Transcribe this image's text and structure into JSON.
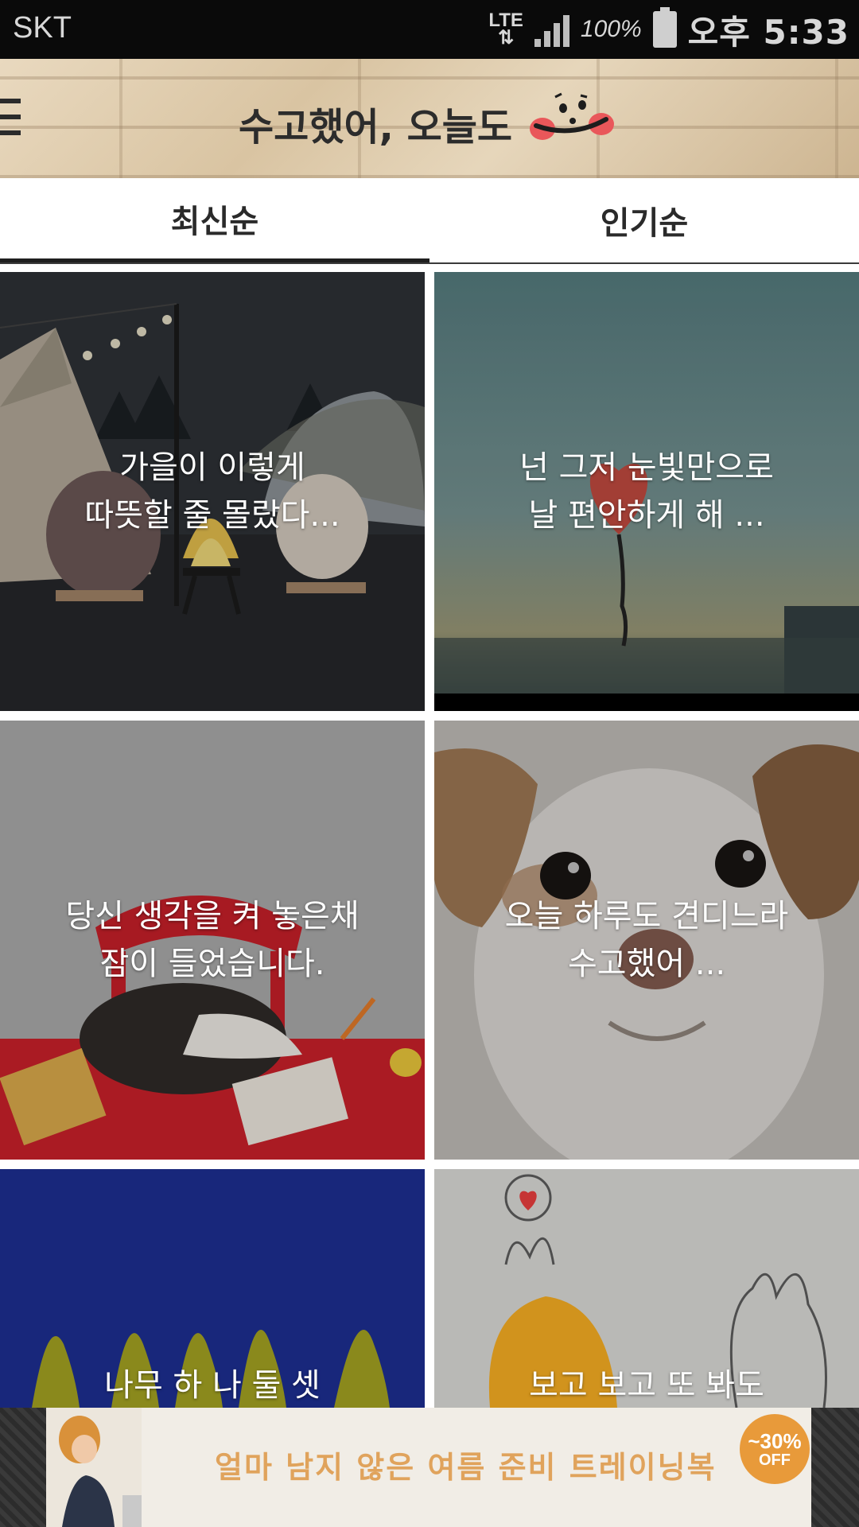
{
  "status_bar": {
    "carrier": "SKT",
    "network": "LTE",
    "battery": "100%",
    "time": "오후 5:33"
  },
  "header": {
    "title": "수고했어, 오늘도",
    "menu_icon": "hamburger-menu-icon",
    "logo_icon": "smiley-face-logo"
  },
  "tabs": [
    {
      "label": "최신순",
      "selected": true
    },
    {
      "label": "인기순",
      "selected": false
    }
  ],
  "cards": [
    {
      "line1": "가을이 이렇게",
      "line2": "따뜻할 줄 몰랐다..."
    },
    {
      "line1": "넌 그저 눈빛만으로",
      "line2": "날 편안하게 해 ..."
    },
    {
      "line1": "당신 생각을 켜 놓은채",
      "line2": "잠이 들었습니다."
    },
    {
      "line1": "오늘 하루도 견디느라",
      "line2": "수고했어 ..."
    },
    {
      "line1": "나무 하 나 둘 셋",
      "line2": ""
    },
    {
      "line1": "보고 보고 또 봐도",
      "line2": ""
    }
  ],
  "ad": {
    "text": "얼마 남지 않은 여름 준비 트레이닝복",
    "badge_percent": "~30%",
    "badge_off": "OFF"
  }
}
